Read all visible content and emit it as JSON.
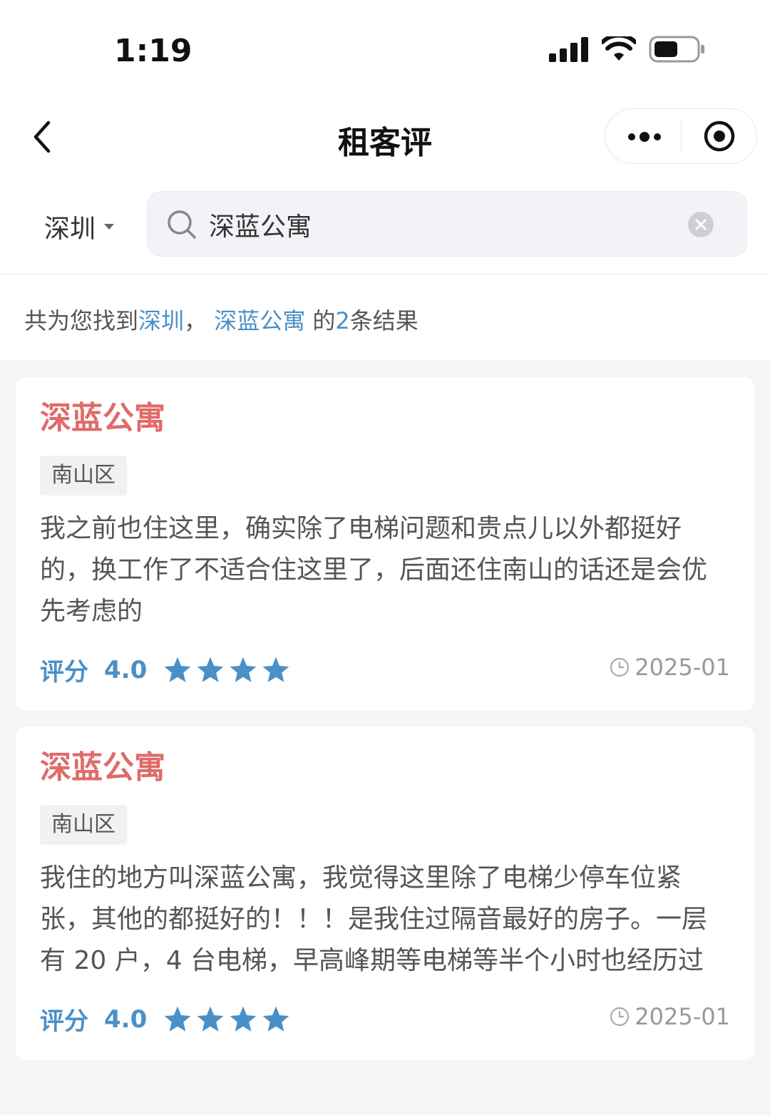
{
  "status_bar": {
    "time": "1:19"
  },
  "nav": {
    "title": "租客评"
  },
  "search": {
    "city": "深圳",
    "query": "深蓝公寓"
  },
  "summary": {
    "prefix": "共为您找到",
    "city": "深圳",
    "sep": "，",
    "keyword": "深蓝公寓",
    "mid": "的",
    "count": "2",
    "suffix": "条结果"
  },
  "accent_color": "#4a90c8",
  "title_color": "#e06b68",
  "reviews": [
    {
      "title": "深蓝公寓",
      "district": "南山区",
      "text": "我之前也住这里，确实除了电梯问题和贵点儿以外都挺好的，换工作了不适合住这里了，后面还住南山的话还是会优先考虑的",
      "score_label": "评分",
      "score": "4.0",
      "stars": 4,
      "date": "2025-01"
    },
    {
      "title": "深蓝公寓",
      "district": "南山区",
      "text": "我住的地方叫深蓝公寓，我觉得这里除了电梯少停车位紧张，其他的都挺好的！！！是我住过隔音最好的房子。一层有 20 户，4 台电梯，早高峰期等电梯等半个小时也经历过",
      "score_label": "评分",
      "score": "4.0",
      "stars": 4,
      "date": "2025-01"
    }
  ]
}
